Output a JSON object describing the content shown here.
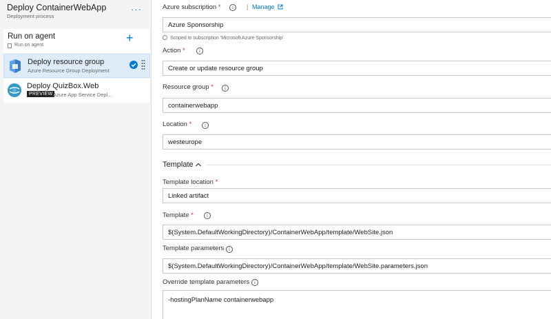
{
  "process": {
    "title": "Deploy ContainerWebApp",
    "subtitle": "Deployment process",
    "more": "···"
  },
  "agent": {
    "title": "Run on agent",
    "subtitle": "Run on agent",
    "add": "+"
  },
  "tasks": [
    {
      "title": "Deploy resource group",
      "subtitle": "Azure Resource Group Deployment",
      "selected": true
    },
    {
      "title": "Deploy QuizBox.Web",
      "badge": "PREVIEW",
      "subtitle": "Azure App Service Depl..."
    }
  ],
  "form": {
    "subscription": {
      "label": "Azure subscription",
      "required": "*",
      "manage": "Manage",
      "separator": "|",
      "value": "Azure Sponsorship",
      "hint": "Scoped to subscription 'Microsoft Azure Sponsorship'"
    },
    "action": {
      "label": "Action",
      "required": "*",
      "value": "Create or update resource group"
    },
    "resource_group": {
      "label": "Resource group",
      "required": "*",
      "value": "containerwebapp"
    },
    "location": {
      "label": "Location",
      "required": "*",
      "value": "westeurope"
    },
    "template_section": {
      "title": "Template"
    },
    "template_location": {
      "label": "Template location",
      "required": "*",
      "value": "Linked artifact"
    },
    "template": {
      "label": "Template",
      "required": "*",
      "value": "$(System.DefaultWorkingDirectory)/ContainerWebApp/template/WebSite.json"
    },
    "template_parameters": {
      "label": "Template parameters",
      "value": "$(System.DefaultWorkingDirectory)/ContainerWebApp/template/WebSite.parameters.json"
    },
    "override_parameters": {
      "label": "Override template parameters",
      "value": "-hostingPlanName containerwebapp"
    }
  },
  "icons": {
    "info": "info-icon",
    "check": "check-circle-icon",
    "resource_group": "resource-group-icon",
    "app_service": "app-service-icon",
    "external_link": "external-link-icon",
    "chevron_up": "chevron-up-icon"
  },
  "colors": {
    "accent": "#0078d4",
    "selected_bg": "#deecf9",
    "required": "#d13438"
  }
}
